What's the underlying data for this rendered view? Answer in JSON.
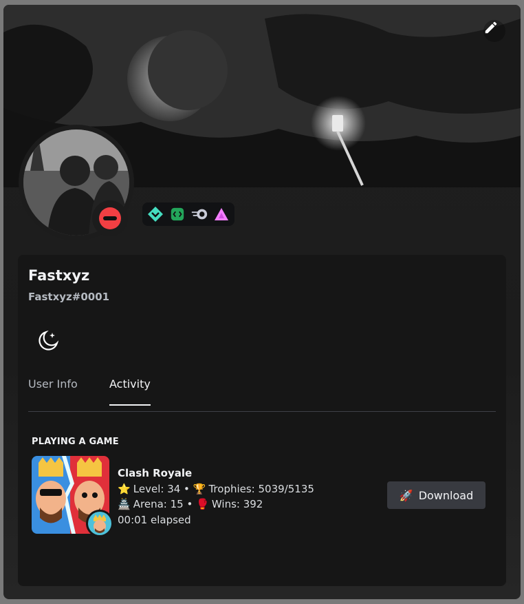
{
  "profile": {
    "display_name": "Fastxyz",
    "username": "Fastxyz#0001",
    "status": "dnd"
  },
  "badges": [
    "hypesquad-balance-icon",
    "active-developer-icon",
    "nitro-orb-icon",
    "boost-triangle-icon"
  ],
  "tabs": [
    {
      "label": "User Info",
      "active": false
    },
    {
      "label": "Activity",
      "active": true
    }
  ],
  "activity": {
    "section_title": "PLAYING A GAME",
    "game_name": "Clash Royale",
    "line1_emoji1": "⭐",
    "line1_text": "Level: 34 •",
    "line1_emoji2": "🏆",
    "line1_text2": "Trophies: 5039/5135",
    "line2_emoji1": "🏯",
    "line2_text": "Arena: 15 •",
    "line2_emoji2": "🥊",
    "line2_text2": "Wins: 392",
    "elapsed": "00:01 elapsed",
    "button_label": "Download",
    "button_emoji": "🚀"
  },
  "colors": {
    "dnd": "#f23f43",
    "card_bg": "#1c1c1c",
    "button_bg": "#383a40"
  }
}
